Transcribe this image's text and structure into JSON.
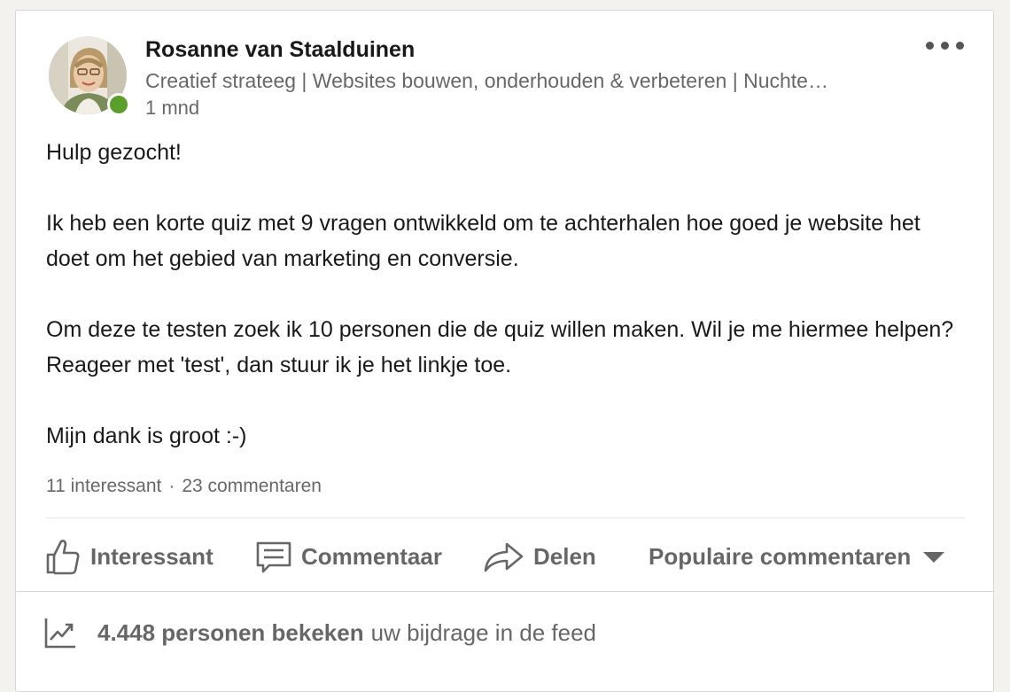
{
  "author": {
    "name": "Rosanne van Staalduinen",
    "headline": "Creatief strateeg | Websites bouwen, onderhouden & verbeteren | Nuchte…",
    "time": "1 mnd",
    "online": true
  },
  "post": {
    "paragraphs": [
      "Hulp gezocht!",
      "Ik heb een korte quiz met 9 vragen ontwikkeld om te achterhalen hoe goed je website het doet om het gebied van marketing en conversie.",
      "Om deze te testen zoek ik 10 personen die de quiz willen maken. Wil je me hiermee helpen? Reageer met 'test', dan stuur ik je het linkje toe.",
      "Mijn dank is groot :-)"
    ]
  },
  "social": {
    "likes": "11 interessant",
    "separator": "·",
    "comments": "23 commentaren"
  },
  "actions": {
    "like": "Interessant",
    "comment": "Commentaar",
    "share": "Delen",
    "sort": "Populaire commentaren"
  },
  "analytics": {
    "count": "4.448 personen bekeken",
    "suffix": "uw bijdrage in de feed"
  },
  "icons": {
    "more": "more-horizontal-icon",
    "like": "thumbs-up-icon",
    "comment": "comment-icon",
    "share": "share-arrow-icon",
    "sort": "caret-down-icon",
    "analytics": "line-chart-icon"
  },
  "colors": {
    "presence": "#5a9e2c",
    "text_primary": "rgba(0,0,0,0.9)",
    "text_secondary": "rgba(0,0,0,0.6)"
  }
}
